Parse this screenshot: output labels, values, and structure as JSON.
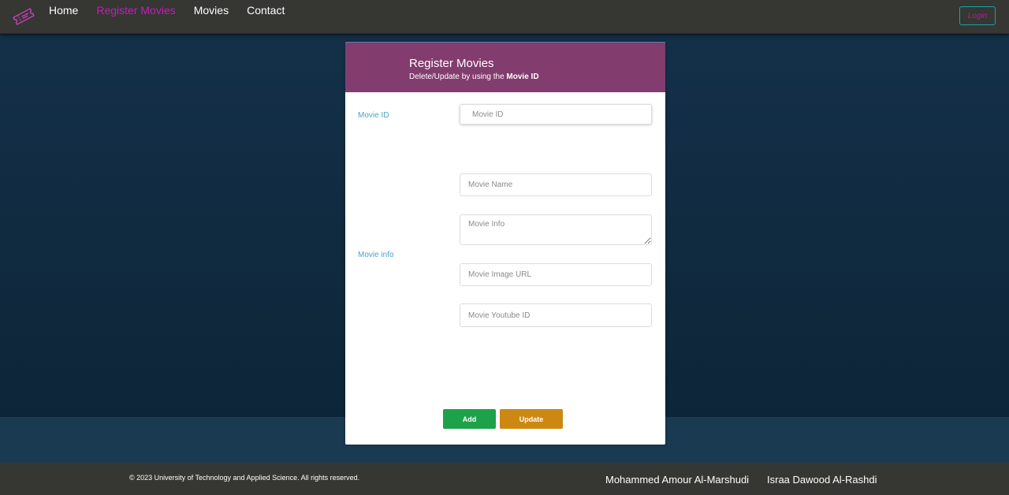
{
  "nav": {
    "logo_icon": "ticket-icon",
    "links": [
      "Home",
      "Register Movies",
      "Movies",
      "Contact"
    ],
    "active_link": "Register Movies",
    "login_label": "Login"
  },
  "card": {
    "title": "Register Movies",
    "subtitle_prefix": "Delete/Update by using the ",
    "subtitle_bold": "Movie ID",
    "movie_id_label": "Movie ID",
    "movie_info_label": "Movie info",
    "fields": {
      "movie_id_placeholder": "Movie ID",
      "movie_name_placeholder": "Movie Name",
      "movie_info_placeholder": "Movie Info",
      "movie_image_url_placeholder": "Movie Image URL",
      "movie_youtube_id_placeholder": "Movie Youtube ID"
    },
    "add_label": "Add",
    "update_label": "Update"
  },
  "footer": {
    "copyright": "© 2023 University of Technology and Applied Science. All rights reserved.",
    "authors": [
      "Mohammed Amour Al-Marshudi",
      "Israa Dawood Al-Rashdi"
    ]
  },
  "colors": {
    "nav_bg": "#363633",
    "active_link": "#c21fb8",
    "card_header": "#823c6e",
    "label": "#4aa3c4",
    "add_button": "#1ea249",
    "update_button": "#cc8811"
  }
}
